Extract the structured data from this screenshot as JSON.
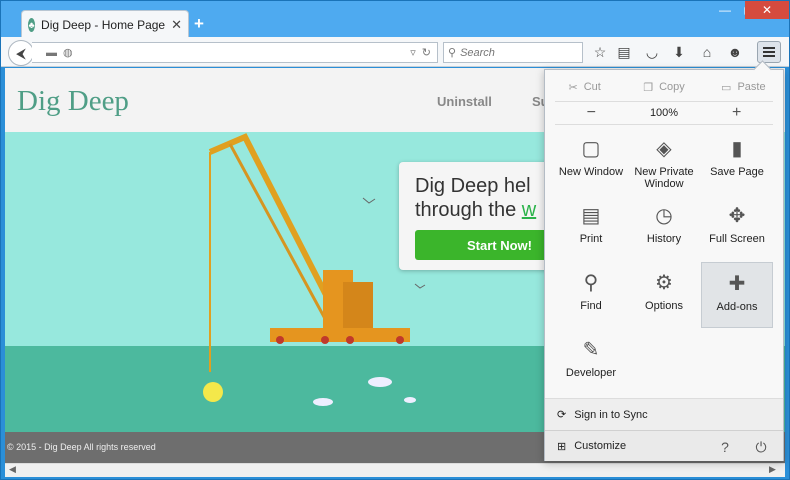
{
  "tab": {
    "title": "Dig Deep - Home Page",
    "close": "✕"
  },
  "newtab": "+",
  "window_controls": {
    "minimize": "—",
    "maximize": "▢",
    "close": "✕"
  },
  "search": {
    "placeholder": "Search"
  },
  "site": {
    "logo": "Dig Deep",
    "nav": [
      "Uninstall",
      "Su"
    ],
    "hero_line1": "Dig Deep hel",
    "hero_line2_prefix": "through the ",
    "hero_line2_link": "w",
    "cta": "Start Now!",
    "footer": "© 2015 - Dig Deep All rights reserved"
  },
  "menu": {
    "cut": "Cut",
    "copy": "Copy",
    "paste": "Paste",
    "zoom_out": "−",
    "zoom": "100%",
    "zoom_in": "+",
    "items": [
      {
        "label": "New Window",
        "icon": "window-icon"
      },
      {
        "label": "New Private Window",
        "icon": "mask-icon"
      },
      {
        "label": "Save Page",
        "icon": "page-icon"
      },
      {
        "label": "Print",
        "icon": "printer-icon"
      },
      {
        "label": "History",
        "icon": "clock-icon"
      },
      {
        "label": "Full Screen",
        "icon": "fullscreen-icon"
      },
      {
        "label": "Find",
        "icon": "magnifier-icon"
      },
      {
        "label": "Options",
        "icon": "gear-icon"
      },
      {
        "label": "Add-ons",
        "icon": "puzzle-icon"
      },
      {
        "label": "Developer",
        "icon": "wrench-icon"
      }
    ],
    "sync": "Sign in to Sync",
    "customize": "Customize"
  }
}
